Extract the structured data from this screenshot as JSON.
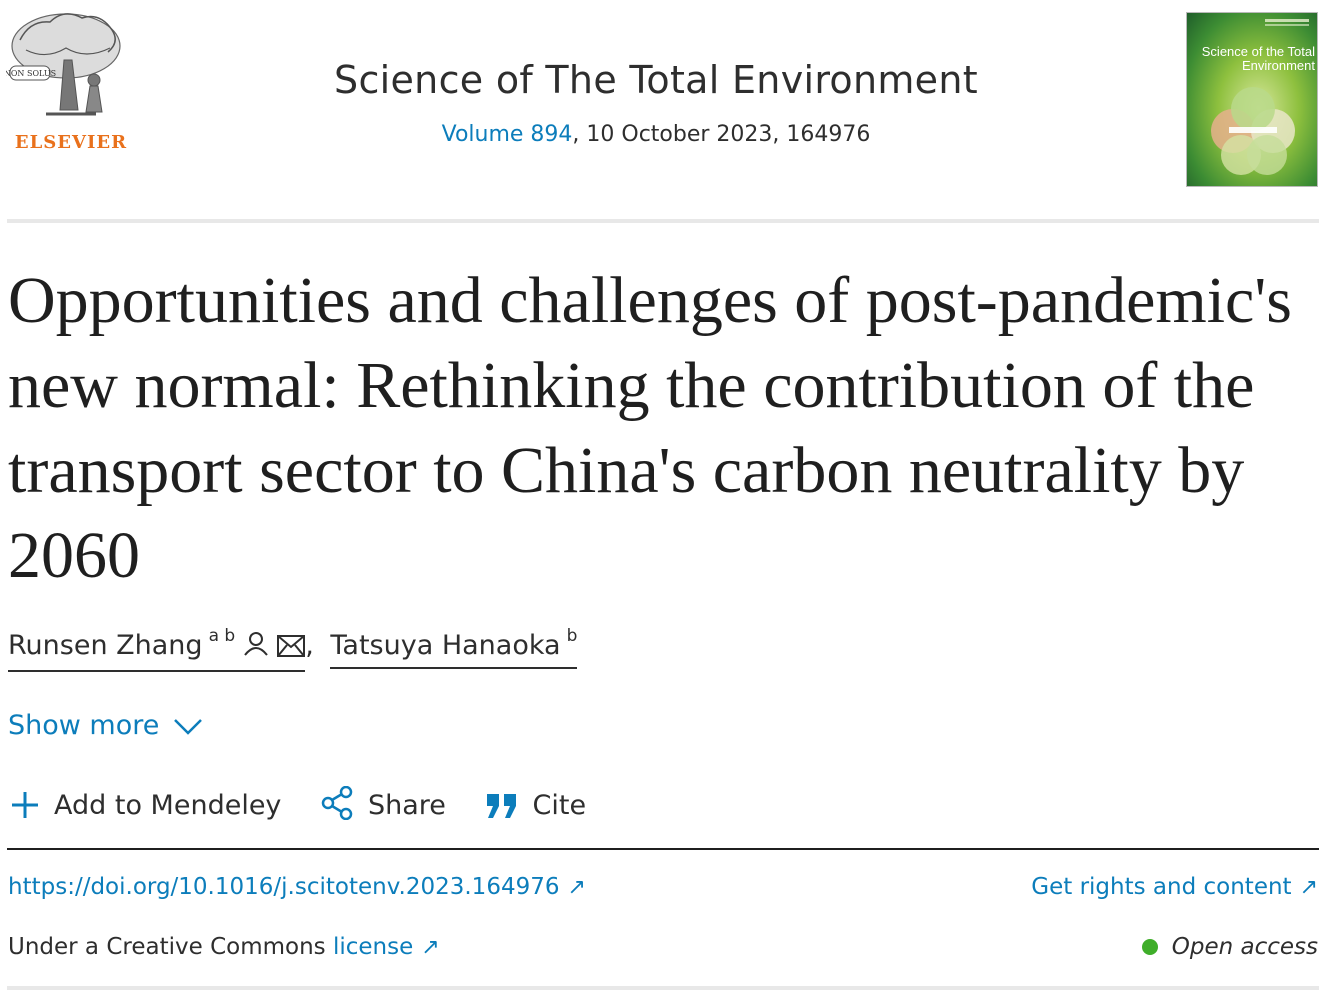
{
  "header": {
    "publisher_logo_text": "ELSEVIER",
    "publisher_motto": "NON SOLUS",
    "journal_title": "Science of The Total Environment",
    "volume_link": "Volume 894",
    "issue_rest": ", 10 October 2023, 164976",
    "cover_title": "Science of the Total Environment"
  },
  "article": {
    "title": "Opportunities and challenges of post-pandemic's new normal: Rethinking the contribution of the transport sector to China's carbon neutrality by 2060",
    "authors": [
      {
        "name": "Runsen Zhang",
        "affil": "a b"
      },
      {
        "name": "Tatsuya Hanaoka",
        "affil": "b"
      }
    ],
    "author_separator": ",",
    "show_more": "Show more"
  },
  "actions": {
    "mendeley": "Add to Mendeley",
    "share": "Share",
    "cite": "Cite"
  },
  "links": {
    "doi": "https://doi.org/10.1016/j.scitotenv.2023.164976",
    "rights": "Get rights and content",
    "license_prefix": "Under a Creative Commons ",
    "license_link": "license",
    "open_access": "Open access",
    "arrow_glyph": "↗"
  },
  "colors": {
    "link": "#0c7dbb",
    "elsevier_orange": "#e9711c",
    "open_access_dot": "#3fae2a"
  }
}
